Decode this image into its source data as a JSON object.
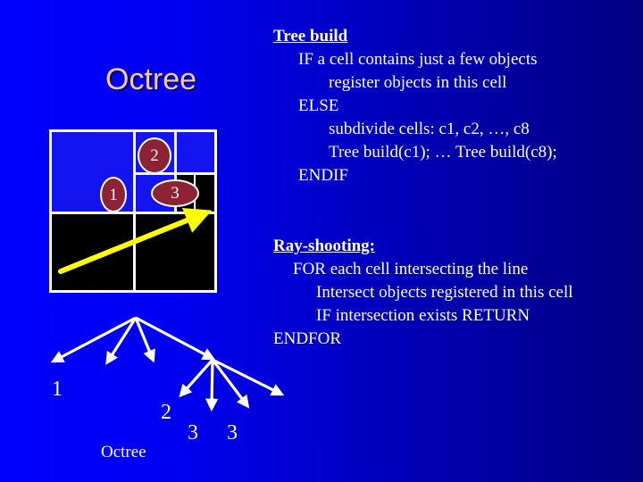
{
  "slide": {
    "background_left": "#0000ff",
    "background_right": "#000080",
    "title": "Octree",
    "title_color": "#f7c9a0"
  },
  "tree_build": {
    "heading": "Tree build",
    "lines": [
      "IF a cell contains just a few objects",
      "register objects in this cell",
      "ELSE",
      "subdivide cells: c1, c2, …, c8",
      "Tree build(c1); … Tree build(c8);",
      "ENDIF"
    ]
  },
  "ray_shooting": {
    "heading": "Ray-shooting:",
    "lines": [
      "FOR each cell intersecting the line",
      "Intersect objects registered in this cell",
      "IF intersection exists RETURN",
      "ENDFOR"
    ]
  },
  "grid_diagram": {
    "cell_fill_blue": "#1414f0",
    "cell_fill_black": "#000000",
    "grid_line_color": "#ffffff",
    "object_fill": "#8c2233",
    "object_outline": "#ffffff",
    "ray_color": "#ffff00",
    "objects": [
      {
        "label": "1"
      },
      {
        "label": "2"
      },
      {
        "label": "3"
      }
    ]
  },
  "tree_diagram": {
    "arrow_color": "#ffffff",
    "caption": "Octree",
    "labels": [
      {
        "text": "1"
      },
      {
        "text": "2"
      },
      {
        "text": "3"
      },
      {
        "text": "3"
      }
    ]
  }
}
